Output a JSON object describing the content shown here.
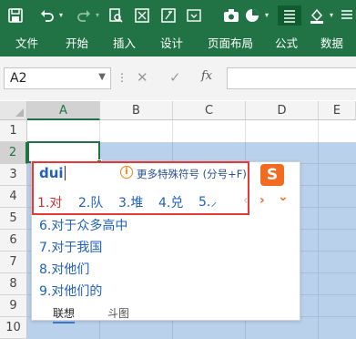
{
  "toolbar": {
    "icons": [
      "save-icon",
      "undo-icon",
      "undo-dropdown-icon",
      "redo-icon",
      "redo-dropdown-icon",
      "print-preview-icon",
      "format-cells-icon",
      "function-icon",
      "camera-icon",
      "pie-chart-icon",
      "dropdown-icon",
      "align-icon",
      "fill-color-icon"
    ]
  },
  "tabs": [
    "文件",
    "开始",
    "插入",
    "设计",
    "页面布局",
    "公式",
    "数据"
  ],
  "formula_bar": {
    "name_box": "A2",
    "cancel_icon": "✕",
    "confirm_icon": "✓",
    "function_icon": "fx",
    "value": ""
  },
  "grid": {
    "columns": [
      "A",
      "B",
      "C",
      "D",
      "E"
    ],
    "selected_column": "A",
    "rows": [
      "1",
      "2",
      "3",
      "4",
      "5",
      "6",
      "7",
      "8",
      "9",
      "10"
    ],
    "selected_row": "2"
  },
  "ime": {
    "composition": "dui",
    "more_symbols_label": "更多特殊符号 (分号+F)",
    "info_icon": "i",
    "logo_text": "S",
    "row_candidates": [
      "1.对",
      "2.队",
      "3.堆",
      "4.兑",
      "5.⸝"
    ],
    "prev_icon": "‹",
    "next_icon": "›",
    "expand_icon": "⌄",
    "list_candidates": [
      "6.对于众多高中",
      "7.对于我国",
      "8.对他们",
      "9.对他们的"
    ],
    "footer_tabs": [
      "联想",
      "斗图"
    ],
    "active_footer_tab": "联想"
  },
  "colors": {
    "ribbon": "#217346",
    "selection": "#217346",
    "highlight": "#e53935",
    "candidate": "#1f5fbf",
    "first_candidate": "#d32f2f"
  }
}
